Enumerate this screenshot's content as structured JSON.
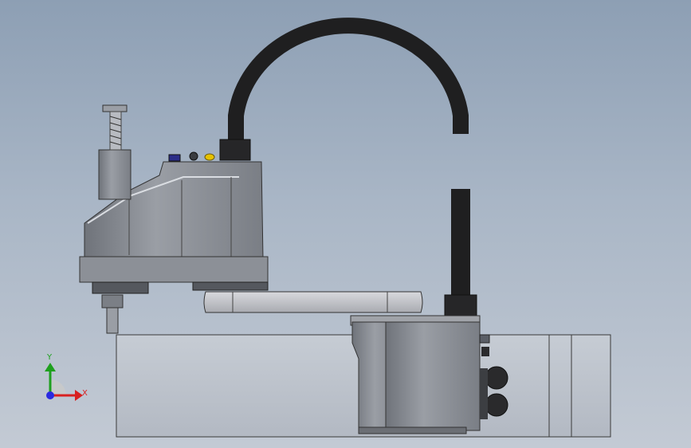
{
  "view": {
    "triad": {
      "x_label": "X",
      "y_label": "Y",
      "x_color": "#d82020",
      "y_color": "#1ea01e",
      "z_color": "#2a2ae0"
    },
    "background_color": "#9fb0c3",
    "model": {
      "body_color": "#8a8e96",
      "cable_color": "#1f1f20",
      "arm_color": "#bfc1c7",
      "table_color": "#b8bec8",
      "status_light_color": "#e7c200"
    }
  }
}
